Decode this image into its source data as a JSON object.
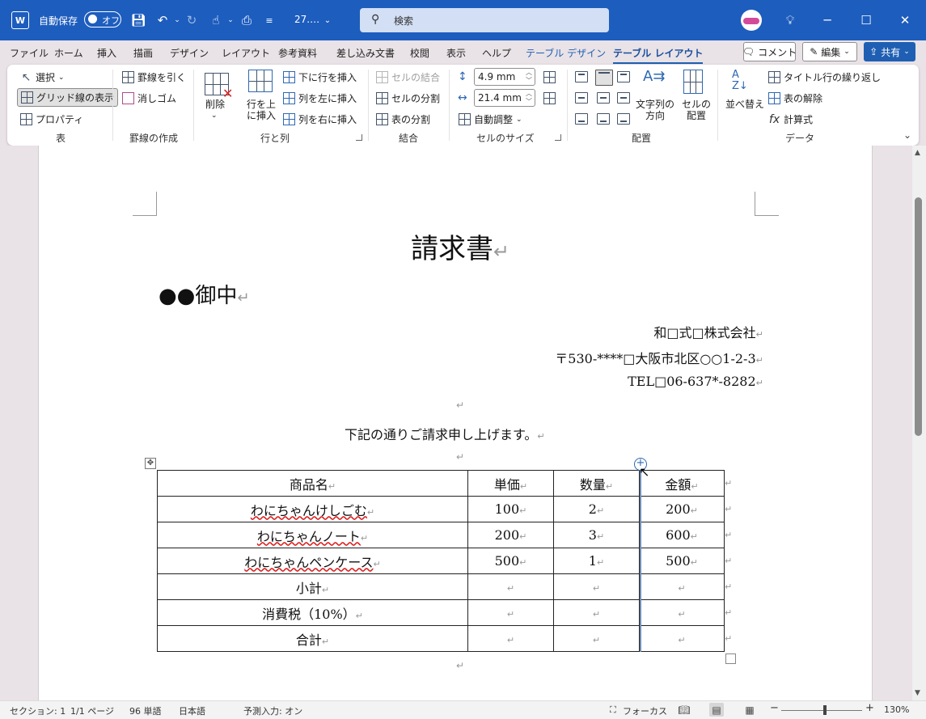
{
  "titlebar": {
    "app_icon": "word-icon",
    "autosave_label": "自動保存",
    "autosave_state": "オフ",
    "filename": "27.…",
    "search_placeholder": "検索",
    "bg": "#1d5dbe"
  },
  "menu": {
    "tabs": [
      "ファイル",
      "ホーム",
      "挿入",
      "描画",
      "デザイン",
      "レイアウト",
      "参考資料",
      "差し込み文書",
      "校閲",
      "表示",
      "ヘルプ"
    ],
    "context_tabs": [
      "テーブル デザイン",
      "テーブル レイアウト"
    ],
    "active": "テーブル レイアウト",
    "comment": "コメント",
    "edit": "編集",
    "share": "共有"
  },
  "ribbon": {
    "table": {
      "select": "選択",
      "gridlines": "グリッド線の表示",
      "properties": "プロパティ",
      "label": "表"
    },
    "draw": {
      "draw_table": "罫線を引く",
      "eraser": "消しゴム",
      "label": "罫線の作成"
    },
    "rowscols": {
      "delete": "削除",
      "insert_above": "行を上\nに挿入",
      "insert_below": "下に行を挿入",
      "insert_left": "列を左に挿入",
      "insert_right": "列を右に挿入",
      "label": "行と列"
    },
    "merge": {
      "merge_cells": "セルの結合",
      "split_cells": "セルの分割",
      "split_table": "表の分割",
      "label": "結合"
    },
    "cellsize": {
      "height": "4.9 mm",
      "width": "21.4 mm",
      "autofit": "自動調整",
      "label": "セルのサイズ"
    },
    "alignment": {
      "text_direction": "文字列の\n方向",
      "cell_margins": "セルの\n配置",
      "label": "配置"
    },
    "data": {
      "sort": "並べ替え",
      "repeat_header": "タイトル行の繰り返し",
      "convert": "表の解除",
      "formula": "計算式",
      "label": "データ"
    }
  },
  "document": {
    "title": "請求書",
    "addressee": "●●御中",
    "sender": [
      "和□式□株式会社",
      "〒530-****□大阪市北区○○1-2-3",
      "TEL□06-637*-8282"
    ],
    "intro": "下記の通りご請求申し上げます。",
    "return_mark": "↵",
    "table": {
      "headers": [
        "商品名",
        "単価",
        "数量",
        "金額"
      ],
      "rows": [
        [
          "わにちゃんけしごむ",
          "100",
          "2",
          "200"
        ],
        [
          "わにちゃんノート",
          "200",
          "3",
          "600"
        ],
        [
          "わにちゃんペンケース",
          "500",
          "1",
          "500"
        ],
        [
          "小計",
          "",
          "",
          ""
        ],
        [
          "消費税（10%）",
          "",
          "",
          ""
        ],
        [
          "合計",
          "",
          "",
          ""
        ]
      ]
    }
  },
  "status": {
    "section": "セクション: 1",
    "page": "1/1 ページ",
    "words": "96 単語",
    "language": "日本語",
    "predictive": "予測入力: オン",
    "focus": "フォーカス",
    "zoom": "130%"
  }
}
